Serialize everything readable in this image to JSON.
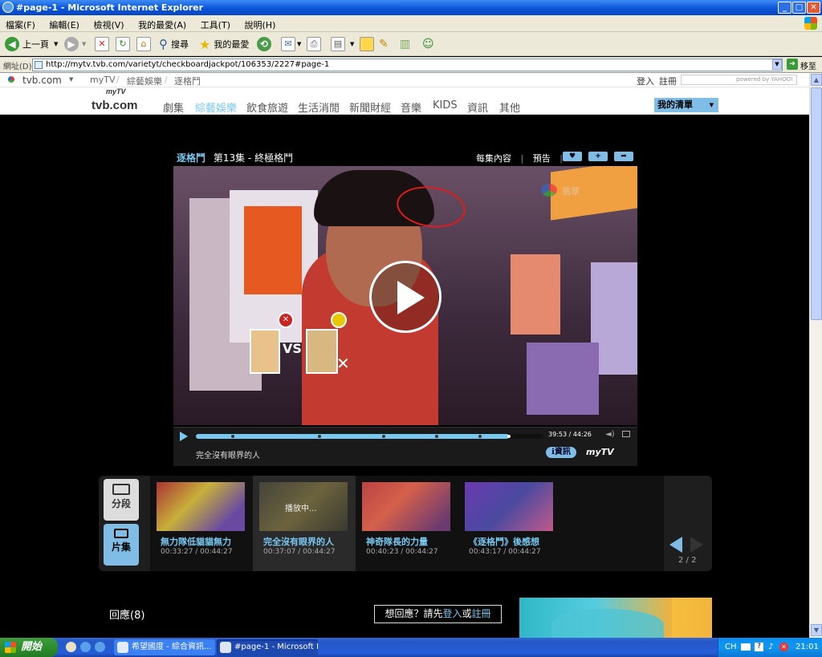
{
  "window": {
    "title": "#page-1 - Microsoft Internet Explorer",
    "min": "_",
    "max": "□",
    "close": "✕"
  },
  "menu": [
    "檔案(F)",
    "編輯(E)",
    "檢視(V)",
    "我的最愛(A)",
    "工具(T)",
    "說明(H)"
  ],
  "toolbar": {
    "back": "上一頁",
    "search": "搜尋",
    "favorites": "我的最愛"
  },
  "address": {
    "label": "網址(D)",
    "url": "http://mytv.tvb.com/varietyt/checkboardjackpot/106353/2227#page-1",
    "go": "移至"
  },
  "topnav": {
    "site": "tvb.com",
    "crumbs": [
      "myTV",
      "綜藝娛樂",
      "逐格鬥"
    ],
    "login": "登入",
    "register": "註冊",
    "search_brand": "powered by YAHOO!"
  },
  "logo": {
    "main": "tvb.com",
    "sub": "myTV"
  },
  "mainnav": [
    {
      "label": "劇集",
      "active": false
    },
    {
      "label": "綜藝娛樂",
      "active": true
    },
    {
      "label": "飲食旅遊",
      "active": false
    },
    {
      "label": "生活消閒",
      "active": false
    },
    {
      "label": "新聞財經",
      "active": false
    },
    {
      "label": "音樂",
      "active": false
    },
    {
      "label": "KIDS",
      "active": false
    },
    {
      "label": "資訊",
      "active": false
    },
    {
      "label": "其他",
      "active": false
    }
  ],
  "mylist": "我的清單",
  "player": {
    "show": "逐格鬥",
    "episode": "第13集 - 終極格鬥",
    "links": [
      "每集內容",
      "預告"
    ],
    "time": "39:53 / 44:26",
    "progress": 0.9,
    "segment_title": "完全沒有眼界的人",
    "info_btn": "資訊",
    "brand": "myTV",
    "vs": "VS",
    "watermark": "翡翠"
  },
  "segments": {
    "tabs": [
      "分段",
      "片集"
    ],
    "items": [
      {
        "name": "無力隊低貓貓無力",
        "time": "00:33:27 / 00:44:27",
        "playing": false
      },
      {
        "name": "完全沒有眼界的人",
        "time": "00:37:07 / 00:44:27",
        "playing": true,
        "overlay": "播放中..."
      },
      {
        "name": "神奇隊長的力量",
        "time": "00:40:23 / 00:44:27",
        "playing": false
      },
      {
        "name": "《逐格鬥》後感想",
        "time": "00:43:17 / 00:44:27",
        "playing": false
      }
    ],
    "page": "2 / 2"
  },
  "comments": {
    "label": "回應(8)",
    "prompt": "想回應？請先",
    "login": "登入",
    "or": "或",
    "register": "註冊"
  },
  "taskbar": {
    "start": "開始",
    "tasks": [
      "希望國度 - 綜合資訊...",
      "#page-1 - Microsoft In..."
    ],
    "lang": "CH",
    "clock": "21:01"
  },
  "colors": {
    "accent": "#7fbde6",
    "link": "#78c8f0",
    "xpblue": "#245ddb"
  }
}
